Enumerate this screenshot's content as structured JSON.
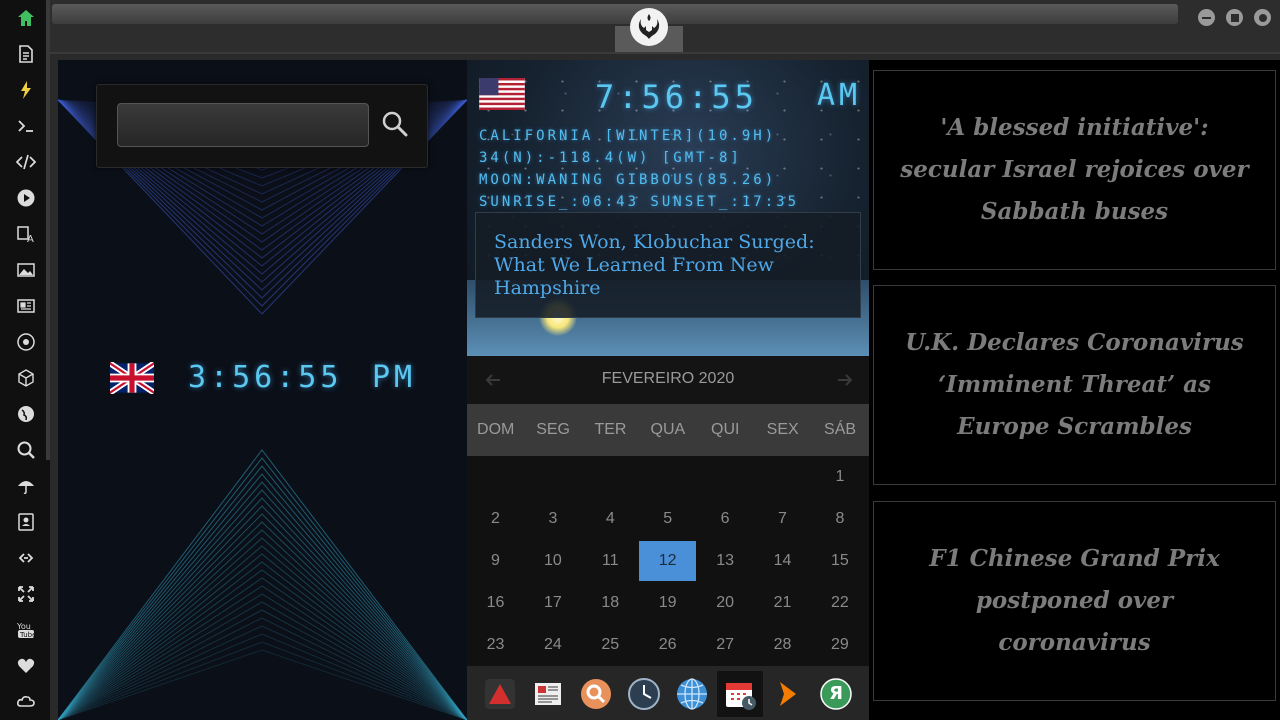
{
  "window": {
    "minimize_icon": "minimize-icon",
    "maximize_icon": "maximize-icon",
    "close_icon": "close-icon"
  },
  "sidebar": {
    "items": [
      {
        "icon": "home-icon",
        "color": "#3fbf5f"
      },
      {
        "icon": "document-icon",
        "color": "#dcdcdc"
      },
      {
        "icon": "bolt-icon",
        "color": "#f0d040"
      },
      {
        "icon": "terminal-icon",
        "color": "#dcdcdc"
      },
      {
        "icon": "code-icon",
        "color": "#dcdcdc"
      },
      {
        "icon": "play-icon",
        "color": "#dcdcdc"
      },
      {
        "icon": "translate-icon",
        "color": "#dcdcdc"
      },
      {
        "icon": "image-icon",
        "color": "#dcdcdc"
      },
      {
        "icon": "newspaper-icon",
        "color": "#dcdcdc"
      },
      {
        "icon": "rebel-icon",
        "color": "#dcdcdc"
      },
      {
        "icon": "cube-icon",
        "color": "#dcdcdc"
      },
      {
        "icon": "globe-icon",
        "color": "#dcdcdc"
      },
      {
        "icon": "search-icon",
        "color": "#dcdcdc"
      },
      {
        "icon": "umbrella-icon",
        "color": "#dcdcdc"
      },
      {
        "icon": "contacts-icon",
        "color": "#dcdcdc"
      },
      {
        "icon": "link-icon",
        "color": "#dcdcdc"
      },
      {
        "icon": "fullscreen-icon",
        "color": "#dcdcdc"
      },
      {
        "icon": "youtube-icon",
        "color": "#dcdcdc"
      },
      {
        "icon": "heart-icon",
        "color": "#dcdcdc"
      },
      {
        "icon": "cloud-icon",
        "color": "#dcdcdc"
      }
    ]
  },
  "search": {
    "value": "",
    "placeholder": ""
  },
  "uk_clock": {
    "time": "3:56:55",
    "ampm": "PM"
  },
  "us_clock": {
    "time": "7:56:55",
    "ampm": "AM",
    "info": [
      "CALIFORNIA [WINTER](10.9H)",
      "34(N):-118.4(W) [GMT-8]",
      "MOON:WANING GIBBOUS(85.26)",
      "SUNRISE_:06:43 SUNSET_:17:35"
    ],
    "headline": "Sanders Won, Klobuchar Surged: What We Learned From New Hampshire"
  },
  "calendar": {
    "month": "FEVEREIRO 2020",
    "weekdays": [
      "DOM",
      "SEG",
      "TER",
      "QUA",
      "QUI",
      "SEX",
      "SÁB"
    ],
    "days": [
      "1",
      "2",
      "3",
      "4",
      "5",
      "6",
      "7",
      "8",
      "9",
      "10",
      "11",
      "12",
      "13",
      "14",
      "15",
      "16",
      "17",
      "18",
      "19",
      "20",
      "21",
      "22",
      "23",
      "24",
      "25",
      "26",
      "27",
      "28",
      "29"
    ],
    "first_weekday": 6,
    "today": "12",
    "accent": "#4a90d9"
  },
  "dock": {
    "items": [
      {
        "icon": "triangle-app-icon"
      },
      {
        "icon": "news-app-icon"
      },
      {
        "icon": "search-app-icon"
      },
      {
        "icon": "clock-app-icon"
      },
      {
        "icon": "globe-app-icon"
      },
      {
        "icon": "calendar-app-icon"
      },
      {
        "icon": "arrow-app-icon"
      },
      {
        "icon": "yandex-app-icon",
        "label": "Я"
      }
    ]
  },
  "news": [
    "'A blessed initiative': secular Israel rejoices over Sabbath buses",
    "U.K. Declares Coronavirus ‘Imminent Threat’ as Europe Scrambles",
    "F1 Chinese Grand Prix postponed over coronavirus"
  ]
}
